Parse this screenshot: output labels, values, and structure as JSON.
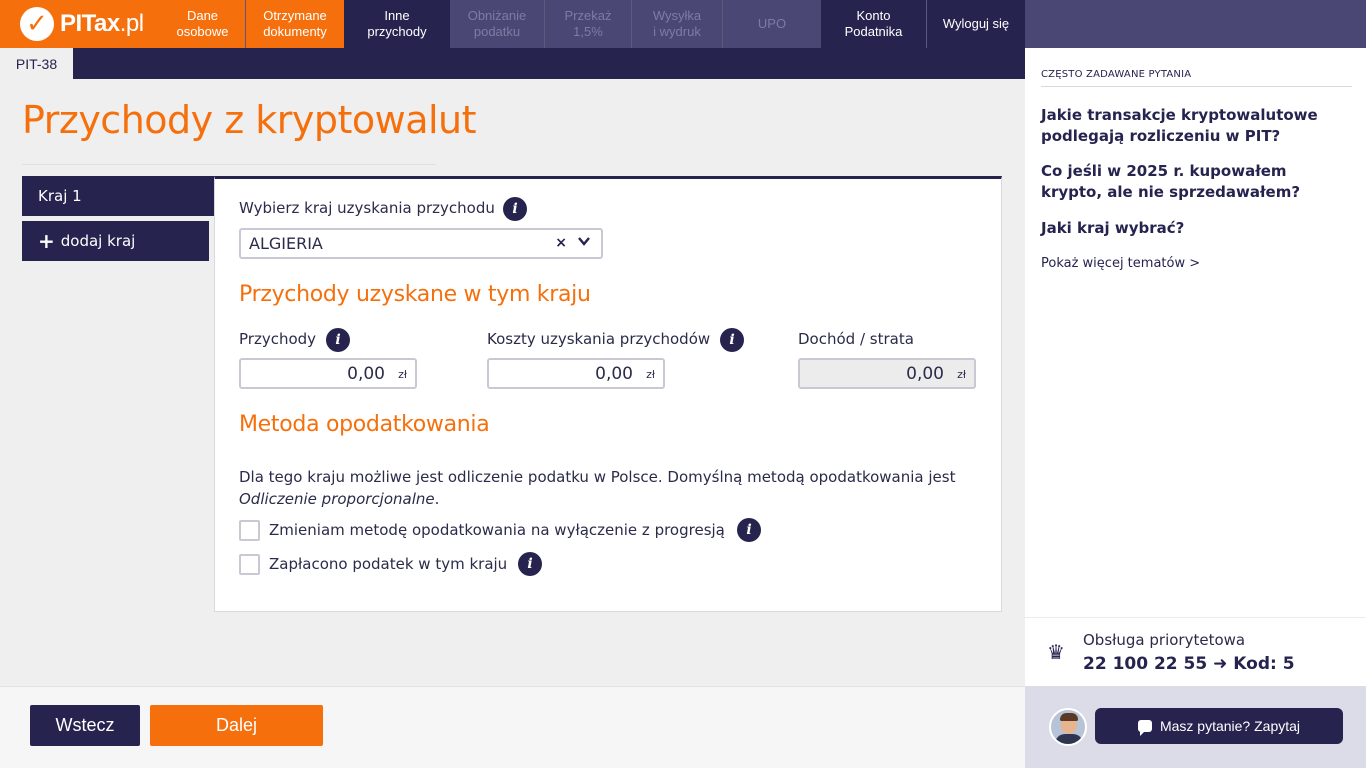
{
  "app": {
    "logo_check": "✓",
    "logo_main": "PITax",
    "logo_suffix": ".pl"
  },
  "steps": [
    {
      "label": "Dane\nosobowe",
      "state": "done"
    },
    {
      "label": "Otrzymane\ndokumenty",
      "state": "done"
    },
    {
      "label": "Inne\nprzychody",
      "state": "active"
    },
    {
      "label": "Obniżanie\npodatku",
      "state": "todo"
    },
    {
      "label": "Przekaż\n1,5%",
      "state": "todo"
    },
    {
      "label": "Wysyłka\ni wydruk",
      "state": "todo"
    },
    {
      "label": "UPO",
      "state": "todo"
    }
  ],
  "account": {
    "label": "Konto\nPodatnika"
  },
  "logout": {
    "label": "Wyloguj się"
  },
  "form_tab": "PIT-38",
  "page_title": "Przychody z kryptowalut",
  "countries": {
    "tab": "Kraj 1",
    "add_icon": "+",
    "add_label": "dodaj kraj"
  },
  "country_select": {
    "label": "Wybierz kraj uzyskania przychodu",
    "value": "ALGIERIA",
    "clear_icon": "×",
    "chevron_icon": "⌄"
  },
  "income_section": {
    "title": "Przychody uzyskane w tym kraju",
    "revenue": {
      "label": "Przychody",
      "value": "0,00",
      "currency": "zł"
    },
    "costs": {
      "label": "Koszty uzyskania przychodów",
      "value": "0,00",
      "currency": "zł"
    },
    "result": {
      "label": "Dochód / strata",
      "value": "0,00",
      "currency": "zł"
    }
  },
  "method_section": {
    "title": "Metoda opodatkowania",
    "desc": "Dla tego kraju możliwe jest odliczenie podatku w Polsce. Domyślną metodą opodatkowania jest ",
    "desc_em": "Odliczenie proporcjonalne",
    "desc_end": ".",
    "option1": "Zmieniam metodę opodatkowania na wyłączenie z progresją",
    "option2": "Zapłacono podatek w tym kraju"
  },
  "info_icon": "i",
  "nav": {
    "back": "Wstecz",
    "next": "Dalej"
  },
  "faq": {
    "heading": "CZĘSTO ZADAWANE PYTANIA",
    "q1": "Jakie transakcje kryptowalutowe podlegają rozliczeniu w PIT?",
    "q2": "Co jeśli w 2025 r. kupowałem krypto, ale nie sprzedawałem?",
    "q3": "Jaki kraj wybrać?",
    "more": "Pokaż więcej tematów >"
  },
  "priority": {
    "label": "Obsługa priorytetowa",
    "number": "22 100 22 55 ➜ Kod: 5",
    "icon": "♛"
  },
  "chat": {
    "label": "Masz pytanie? Zapytaj"
  },
  "colors": {
    "accent": "#f5700d",
    "navy": "#26234f"
  }
}
